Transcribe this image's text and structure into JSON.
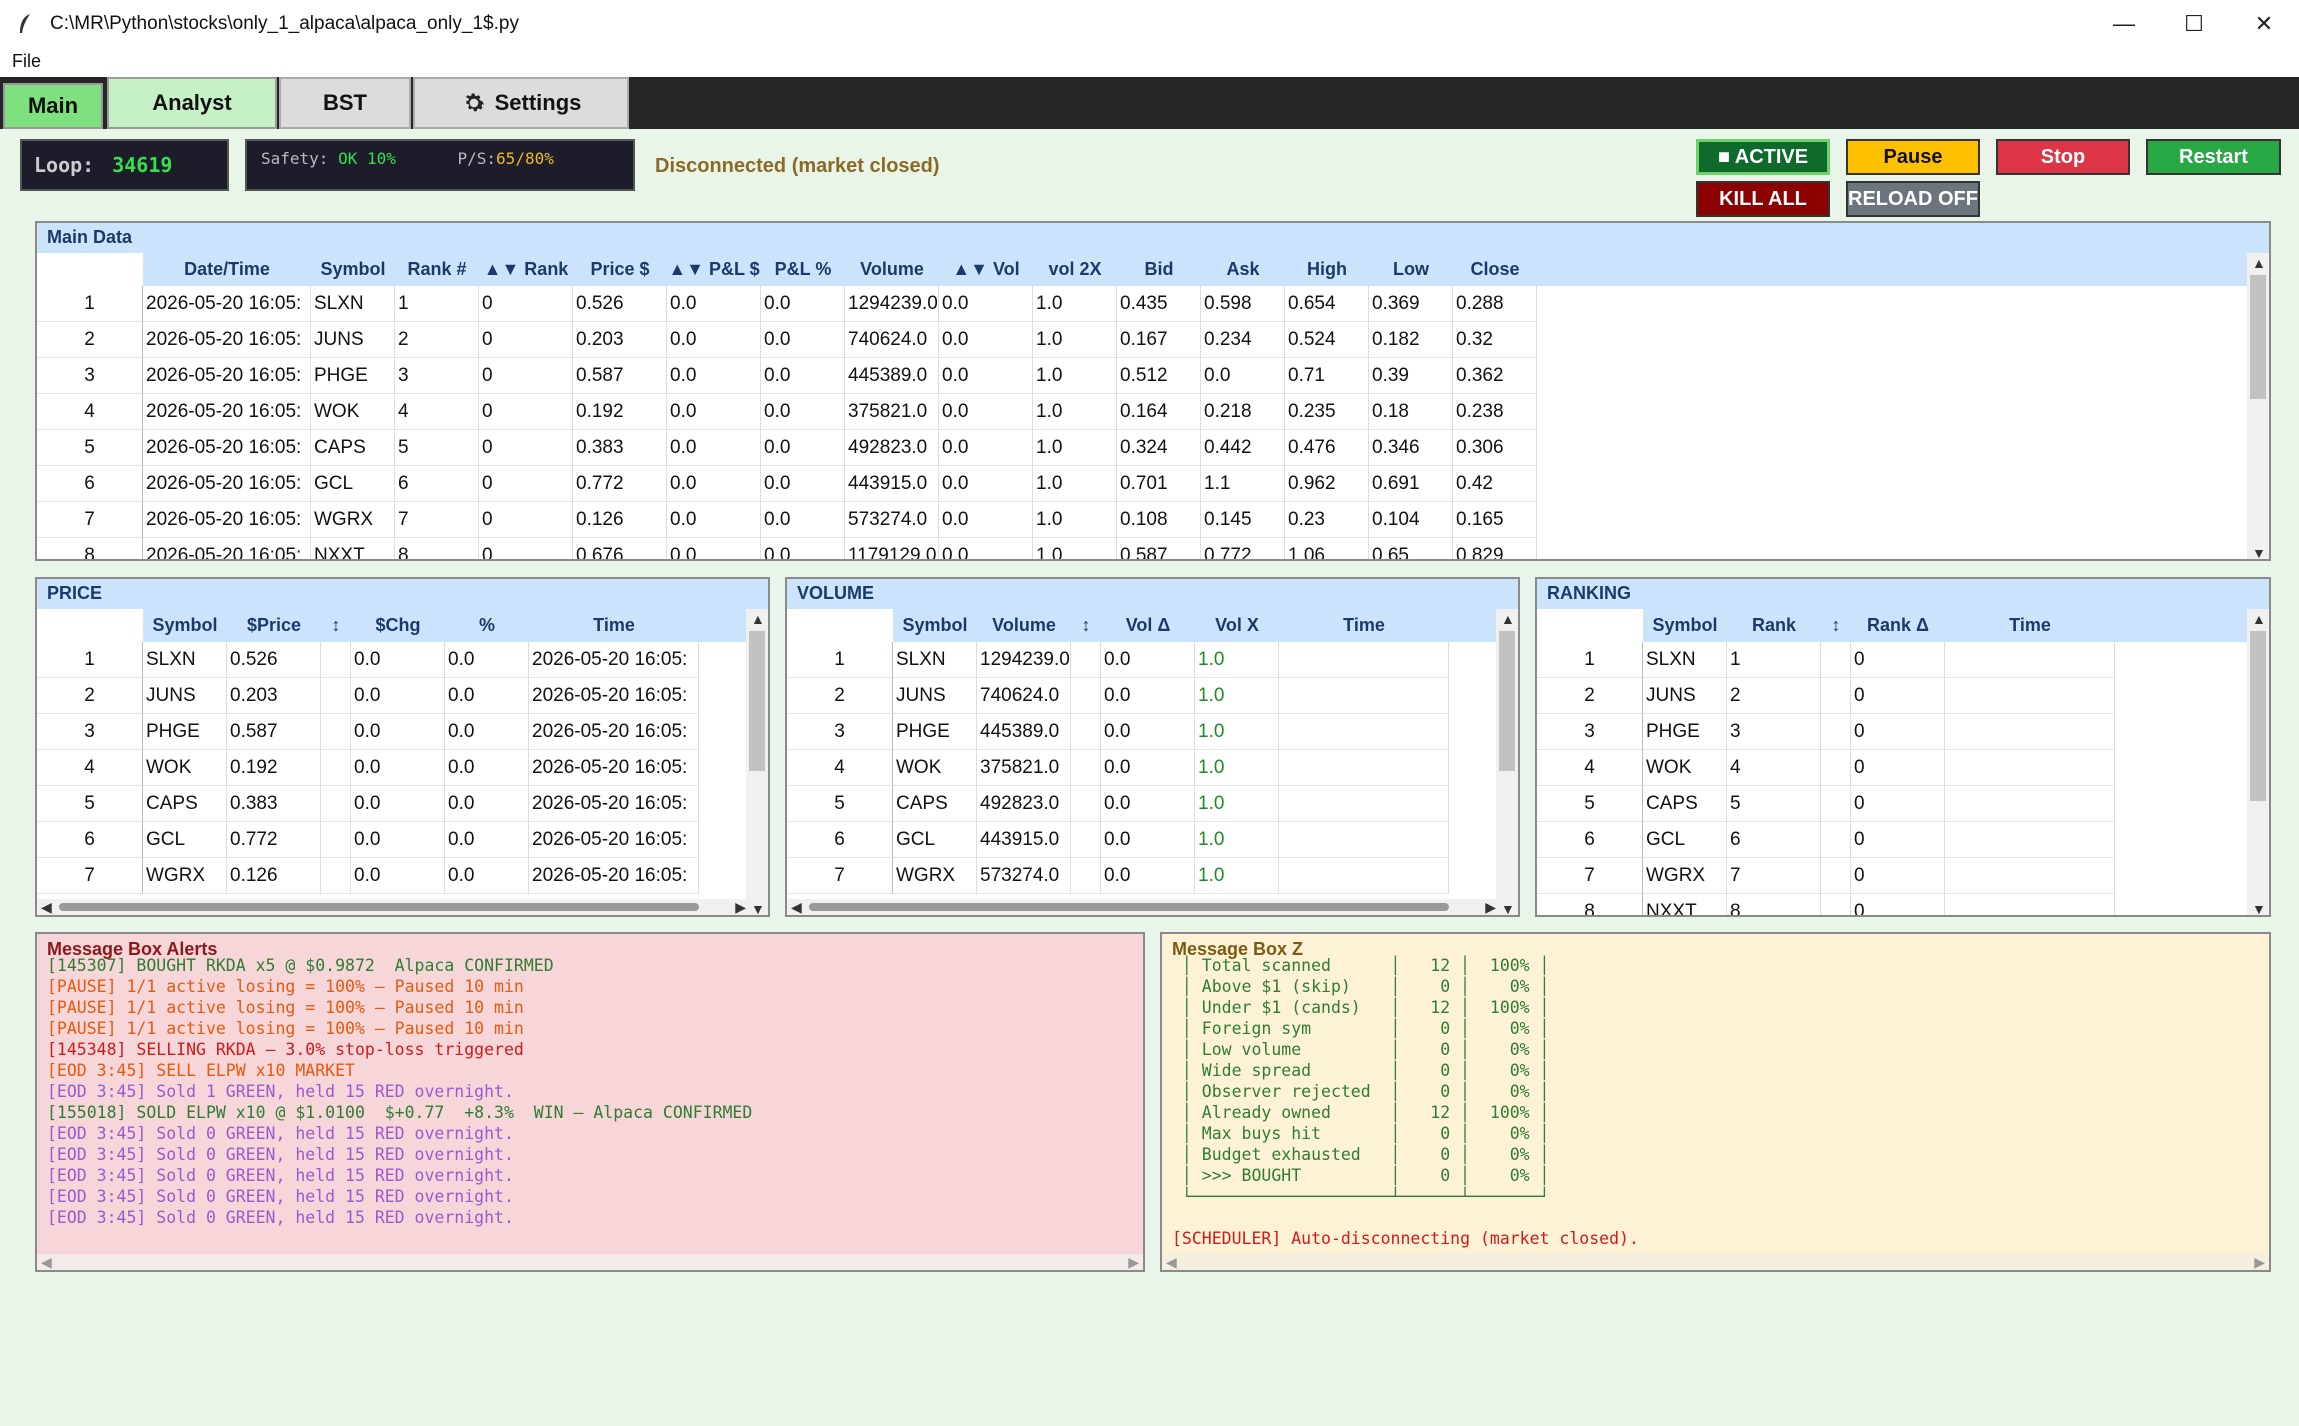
{
  "window": {
    "title": "C:\\MR\\Python\\stocks\\only_1_alpaca\\alpaca_only_1$.py",
    "minimize": "—",
    "maximize": "☐",
    "close": "✕"
  },
  "menu": {
    "file": "File"
  },
  "tabs": [
    {
      "label": "Main"
    },
    {
      "label": "Analyst"
    },
    {
      "label": "BST"
    },
    {
      "label": "Settings",
      "icon": "gear-icon"
    }
  ],
  "status": {
    "loop_label": "Loop:",
    "loop_value": "34619",
    "safety_label": "Safety:",
    "safety_value": "OK 10%",
    "ps_label": "P/S:",
    "ps_value": "65/80%",
    "connection": "Disconnected (market closed)"
  },
  "controls": {
    "active": "■ ACTIVE",
    "pause": "Pause",
    "stop": "Stop",
    "restart": "Restart",
    "kill_all": "KILL ALL",
    "reload": "RELOAD OFF"
  },
  "main_data": {
    "title": "Main Data",
    "columns": [
      "",
      "Date/Time",
      "Symbol",
      "Rank #",
      "▲▼ Rank",
      "Price $",
      "▲▼ P&L $",
      "P&L %",
      "Volume",
      "▲▼ Vol",
      "vol 2X",
      "Bid",
      "Ask",
      "High",
      "Low",
      "Close"
    ],
    "rows": [
      [
        "1",
        "2026-05-20 16:05:",
        "SLXN",
        "1",
        "0",
        "0.526",
        "0.0",
        "0.0",
        "1294239.0",
        "0.0",
        "1.0",
        "0.435",
        "0.598",
        "0.654",
        "0.369",
        "0.288"
      ],
      [
        "2",
        "2026-05-20 16:05:",
        "JUNS",
        "2",
        "0",
        "0.203",
        "0.0",
        "0.0",
        "740624.0",
        "0.0",
        "1.0",
        "0.167",
        "0.234",
        "0.524",
        "0.182",
        "0.32"
      ],
      [
        "3",
        "2026-05-20 16:05:",
        "PHGE",
        "3",
        "0",
        "0.587",
        "0.0",
        "0.0",
        "445389.0",
        "0.0",
        "1.0",
        "0.512",
        "0.0",
        "0.71",
        "0.39",
        "0.362"
      ],
      [
        "4",
        "2026-05-20 16:05:",
        "WOK",
        "4",
        "0",
        "0.192",
        "0.0",
        "0.0",
        "375821.0",
        "0.0",
        "1.0",
        "0.164",
        "0.218",
        "0.235",
        "0.18",
        "0.238"
      ],
      [
        "5",
        "2026-05-20 16:05:",
        "CAPS",
        "5",
        "0",
        "0.383",
        "0.0",
        "0.0",
        "492823.0",
        "0.0",
        "1.0",
        "0.324",
        "0.442",
        "0.476",
        "0.346",
        "0.306"
      ],
      [
        "6",
        "2026-05-20 16:05:",
        "GCL",
        "6",
        "0",
        "0.772",
        "0.0",
        "0.0",
        "443915.0",
        "0.0",
        "1.0",
        "0.701",
        "1.1",
        "0.962",
        "0.691",
        "0.42"
      ],
      [
        "7",
        "2026-05-20 16:05:",
        "WGRX",
        "7",
        "0",
        "0.126",
        "0.0",
        "0.0",
        "573274.0",
        "0.0",
        "1.0",
        "0.108",
        "0.145",
        "0.23",
        "0.104",
        "0.165"
      ],
      [
        "8",
        "2026-05-20 16:05:",
        "NXXT",
        "8",
        "0",
        "0.676",
        "0.0",
        "0.0",
        "1179129.0",
        "0.0",
        "1.0",
        "0.587",
        "0.772",
        "1.06",
        "0.65",
        "0.829"
      ]
    ]
  },
  "price_panel": {
    "title": "PRICE",
    "columns": [
      "",
      "Symbol",
      "$Price",
      "↕",
      "$Chg",
      "%",
      "Time"
    ],
    "rows": [
      [
        "1",
        "SLXN",
        "0.526",
        "",
        "0.0",
        "0.0",
        "2026-05-20 16:05:"
      ],
      [
        "2",
        "JUNS",
        "0.203",
        "",
        "0.0",
        "0.0",
        "2026-05-20 16:05:"
      ],
      [
        "3",
        "PHGE",
        "0.587",
        "",
        "0.0",
        "0.0",
        "2026-05-20 16:05:"
      ],
      [
        "4",
        "WOK",
        "0.192",
        "",
        "0.0",
        "0.0",
        "2026-05-20 16:05:"
      ],
      [
        "5",
        "CAPS",
        "0.383",
        "",
        "0.0",
        "0.0",
        "2026-05-20 16:05:"
      ],
      [
        "6",
        "GCL",
        "0.772",
        "",
        "0.0",
        "0.0",
        "2026-05-20 16:05:"
      ],
      [
        "7",
        "WGRX",
        "0.126",
        "",
        "0.0",
        "0.0",
        "2026-05-20 16:05:"
      ]
    ]
  },
  "volume_panel": {
    "title": "VOLUME",
    "columns": [
      "",
      "Symbol",
      "Volume",
      "↕",
      "Vol Δ",
      "Vol X",
      "Time"
    ],
    "rows": [
      [
        "1",
        "SLXN",
        "1294239.0",
        "",
        "0.0",
        "1.0",
        ""
      ],
      [
        "2",
        "JUNS",
        "740624.0",
        "",
        "0.0",
        "1.0",
        ""
      ],
      [
        "3",
        "PHGE",
        "445389.0",
        "",
        "0.0",
        "1.0",
        ""
      ],
      [
        "4",
        "WOK",
        "375821.0",
        "",
        "0.0",
        "1.0",
        ""
      ],
      [
        "5",
        "CAPS",
        "492823.0",
        "",
        "0.0",
        "1.0",
        ""
      ],
      [
        "6",
        "GCL",
        "443915.0",
        "",
        "0.0",
        "1.0",
        ""
      ],
      [
        "7",
        "WGRX",
        "573274.0",
        "",
        "0.0",
        "1.0",
        ""
      ]
    ]
  },
  "ranking_panel": {
    "title": "RANKING",
    "columns": [
      "",
      "Symbol",
      "Rank",
      "↕",
      "Rank Δ",
      "Time"
    ],
    "rows": [
      [
        "1",
        "SLXN",
        "1",
        "",
        "0",
        ""
      ],
      [
        "2",
        "JUNS",
        "2",
        "",
        "0",
        ""
      ],
      [
        "3",
        "PHGE",
        "3",
        "",
        "0",
        ""
      ],
      [
        "4",
        "WOK",
        "4",
        "",
        "0",
        ""
      ],
      [
        "5",
        "CAPS",
        "5",
        "",
        "0",
        ""
      ],
      [
        "6",
        "GCL",
        "6",
        "",
        "0",
        ""
      ],
      [
        "7",
        "WGRX",
        "7",
        "",
        "0",
        ""
      ],
      [
        "8",
        "NXXT",
        "8",
        "",
        "0",
        ""
      ]
    ]
  },
  "alerts": {
    "title": "Message Box Alerts",
    "lines": [
      {
        "text": "[145307] BOUGHT RKDA x5 @ $0.9872  Alpaca CONFIRMED",
        "color": "#2e7d32"
      },
      {
        "text": "[PAUSE] 1/1 active losing = 100% — Paused 10 min",
        "color": "#e8590c"
      },
      {
        "text": "[PAUSE] 1/1 active losing = 100% — Paused 10 min",
        "color": "#e8590c"
      },
      {
        "text": "[PAUSE] 1/1 active losing = 100% — Paused 10 min",
        "color": "#e8590c"
      },
      {
        "text": "[145348] SELLING RKDA — 3.0% stop-loss triggered",
        "color": "#d11a1a"
      },
      {
        "text": "[EOD 3:45] SELL ELPW x10 MARKET",
        "color": "#e8590c"
      },
      {
        "text": "[EOD 3:45] Sold 1 GREEN, held 15 RED overnight.",
        "color": "#9b59d0"
      },
      {
        "text": "[155018] SOLD ELPW x10 @ $1.0100  $+0.77  +8.3%  WIN — Alpaca CONFIRMED",
        "color": "#2e7d32"
      },
      {
        "text": "[EOD 3:45] Sold 0 GREEN, held 15 RED overnight.",
        "color": "#9b59d0"
      },
      {
        "text": "[EOD 3:45] Sold 0 GREEN, held 15 RED overnight.",
        "color": "#9b59d0"
      },
      {
        "text": "[EOD 3:45] Sold 0 GREEN, held 15 RED overnight.",
        "color": "#9b59d0"
      },
      {
        "text": "[EOD 3:45] Sold 0 GREEN, held 15 RED overnight.",
        "color": "#9b59d0"
      },
      {
        "text": "[EOD 3:45] Sold 0 GREEN, held 15 RED overnight.",
        "color": "#9b59d0"
      }
    ]
  },
  "msgz": {
    "title": "Message Box Z",
    "lines": [
      {
        "text": " │ Total scanned      │   12 │  100% │",
        "color": "#2e7d32"
      },
      {
        "text": " │ Above $1 (skip)    │    0 │    0% │",
        "color": "#2e7d32"
      },
      {
        "text": " │ Under $1 (cands)   │   12 │  100% │",
        "color": "#2e7d32"
      },
      {
        "text": " │ Foreign sym        │    0 │    0% │",
        "color": "#2e7d32"
      },
      {
        "text": " │ Low volume         │    0 │    0% │",
        "color": "#2e7d32"
      },
      {
        "text": " │ Wide spread        │    0 │    0% │",
        "color": "#2e7d32"
      },
      {
        "text": " │ Observer rejected  │    0 │    0% │",
        "color": "#2e7d32"
      },
      {
        "text": " │ Already owned      │   12 │  100% │",
        "color": "#2e7d32"
      },
      {
        "text": " │ Max buys hit       │    0 │    0% │",
        "color": "#2e7d32"
      },
      {
        "text": " │ Budget exhausted   │    0 │    0% │",
        "color": "#2e7d32"
      },
      {
        "text": " │ >>> BOUGHT         │    0 │    0% │",
        "color": "#2e7d32"
      },
      {
        "text": " └────────────────────┴──────┴───────┘",
        "color": "#2e7d32"
      },
      {
        "text": "",
        "color": "#2e7d32"
      },
      {
        "text": "[SCHEDULER] Auto-disconnecting (market closed).",
        "color": "#d11a1a"
      }
    ]
  }
}
